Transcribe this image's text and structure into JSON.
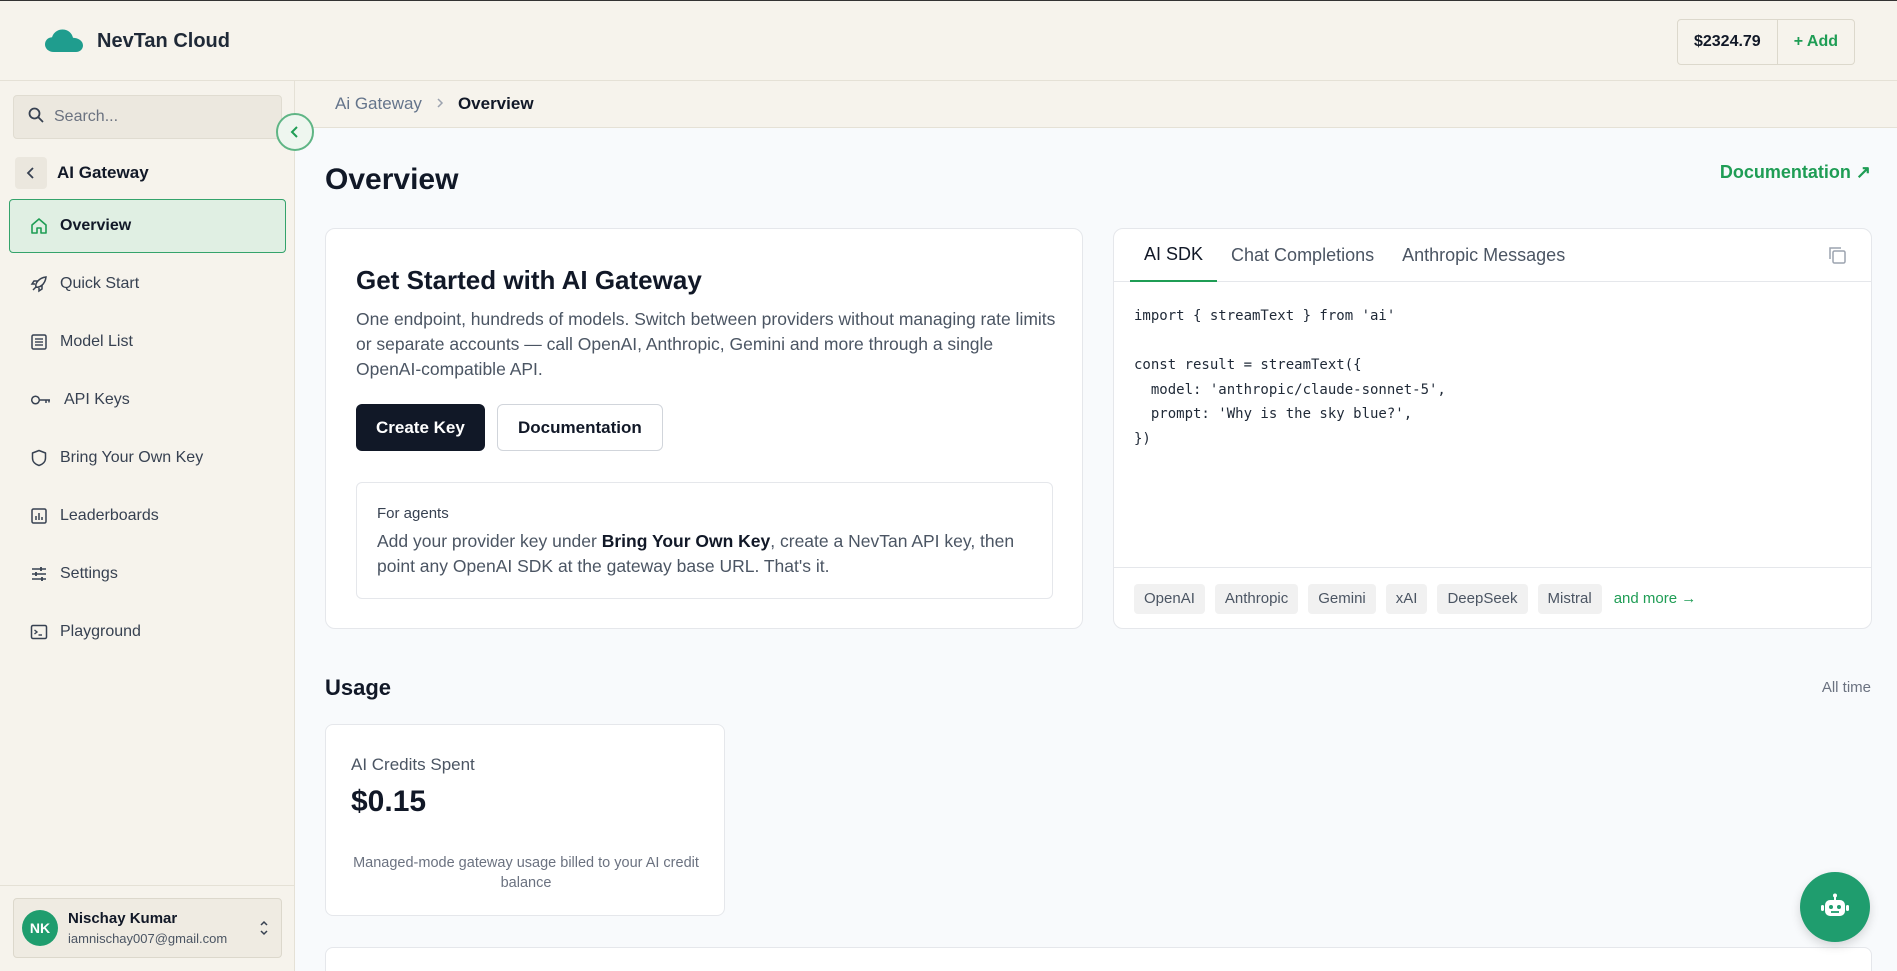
{
  "app": {
    "brand_name": "NevTan Cloud"
  },
  "header": {
    "balance": "$2324.79",
    "add_label": "+ Add"
  },
  "sidebar": {
    "search_placeholder": "Search...",
    "section_title": "AI Gateway",
    "items": [
      {
        "label": "Overview",
        "icon": "home-icon",
        "active": true
      },
      {
        "label": "Quick Start",
        "icon": "rocket-icon"
      },
      {
        "label": "Model List",
        "icon": "list-icon"
      },
      {
        "label": "API Keys",
        "icon": "key-icon"
      },
      {
        "label": "Bring Your Own Key",
        "icon": "shield-icon"
      },
      {
        "label": "Leaderboards",
        "icon": "chart-icon"
      },
      {
        "label": "Settings",
        "icon": "sliders-icon"
      },
      {
        "label": "Playground",
        "icon": "terminal-icon"
      }
    ],
    "user": {
      "initials": "NK",
      "name": "Nischay Kumar",
      "email": "iamnischay007@gmail.com"
    }
  },
  "breadcrumb": {
    "parent": "Ai Gateway",
    "current": "Overview"
  },
  "main": {
    "title": "Overview",
    "doc_link": "Documentation ↗",
    "get_started": {
      "title": "Get Started with AI Gateway",
      "description": "One endpoint, hundreds of models. Switch between providers without managing rate limits or separate accounts — call OpenAI, Anthropic, Gemini and more through a single OpenAI-compatible API.",
      "create_key": "Create Key",
      "documentation": "Documentation",
      "agents": {
        "title": "For agents",
        "text_before": "Add your provider key under ",
        "text_bold": "Bring Your Own Key",
        "text_after": ", create a NevTan API key, then point any OpenAI SDK at the gateway base URL. That's it."
      }
    },
    "code_panel": {
      "tabs": [
        "AI SDK",
        "Chat Completions",
        "Anthropic Messages"
      ],
      "active_tab": "AI SDK",
      "code": "import { streamText } from 'ai'\n\nconst result = streamText({\n  model: 'anthropic/claude-sonnet-5',\n  prompt: 'Why is the sky blue?',\n})",
      "providers": [
        "OpenAI",
        "Anthropic",
        "Gemini",
        "xAI",
        "DeepSeek",
        "Mistral"
      ],
      "more": "and more →"
    },
    "usage": {
      "title": "Usage",
      "range": "All time",
      "credits_label": "AI Credits Spent",
      "credits_value": "$0.15",
      "credits_note": "Managed-mode gateway usage billed to your AI credit balance"
    }
  },
  "colors": {
    "accent": "#1f9d55",
    "fab": "#1f9d6e",
    "dark_button": "#111827"
  }
}
